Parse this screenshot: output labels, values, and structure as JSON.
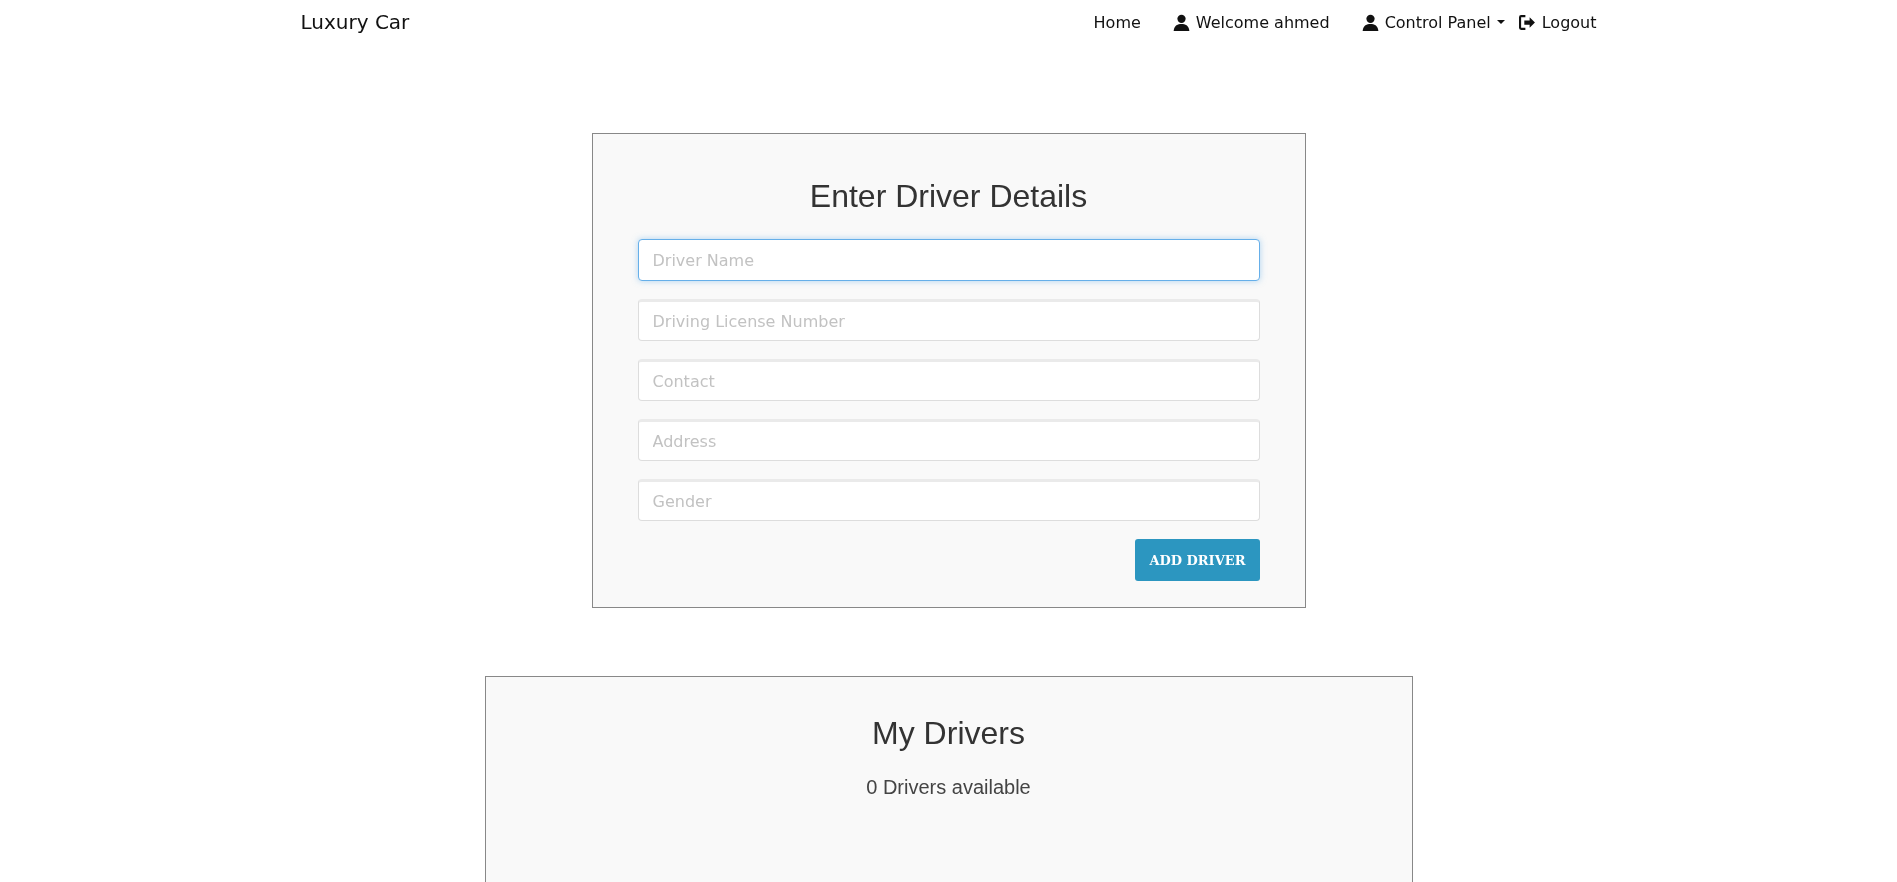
{
  "navbar": {
    "brand": "Luxury Car",
    "items": [
      {
        "kind": "link",
        "label": "Home"
      },
      {
        "kind": "user",
        "label": "Welcome ahmed"
      },
      {
        "kind": "dropdown",
        "label": "Control Panel"
      },
      {
        "kind": "logout",
        "label": "Logout"
      }
    ]
  },
  "driver_form": {
    "title": "Enter Driver Details",
    "fields": [
      {
        "placeholder": "Driver Name",
        "focused": true
      },
      {
        "placeholder": "Driving License Number",
        "focused": false
      },
      {
        "placeholder": "Contact",
        "focused": false
      },
      {
        "placeholder": "Address",
        "focused": false
      },
      {
        "placeholder": "Gender",
        "focused": false
      }
    ],
    "submit": "ADD DRIVER"
  },
  "drivers_panel": {
    "title": "My Drivers",
    "count": "0 Drivers available"
  }
}
